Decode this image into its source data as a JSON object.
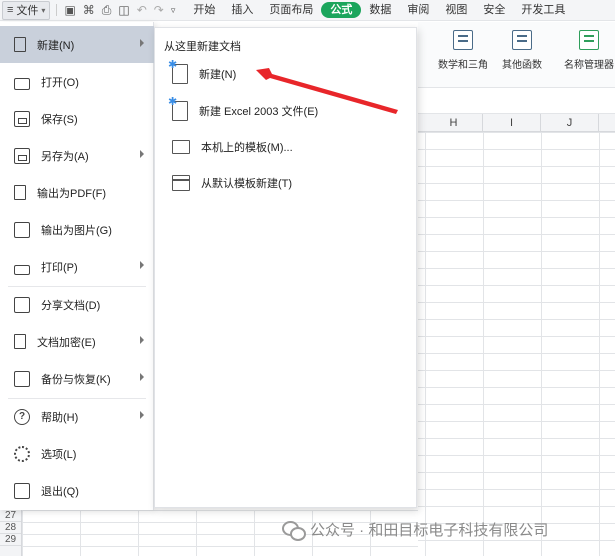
{
  "menubar": {
    "file_label": "文件",
    "tabs": [
      {
        "label": "开始",
        "active": false
      },
      {
        "label": "插入",
        "active": false
      },
      {
        "label": "页面布局",
        "active": false
      },
      {
        "label": "公式",
        "active": true
      },
      {
        "label": "数据",
        "active": false
      },
      {
        "label": "审阅",
        "active": false
      },
      {
        "label": "视图",
        "active": false
      },
      {
        "label": "安全",
        "active": false
      },
      {
        "label": "开发工具",
        "active": false
      }
    ],
    "accent_color": "#1ba55c"
  },
  "ribbon": {
    "math": "数学和三角",
    "other": "其他函数",
    "name_manager": "名称管理器"
  },
  "columns": [
    "H",
    "I",
    "J"
  ],
  "rows": [
    "27",
    "28",
    "29"
  ],
  "file_menu": {
    "items": [
      {
        "label": "新建(N)",
        "icon": "new-doc-icon",
        "submenu": true,
        "active": true
      },
      {
        "label": "打开(O)",
        "icon": "folder-icon",
        "submenu": false
      },
      {
        "label": "保存(S)",
        "icon": "save-icon",
        "submenu": false
      },
      {
        "label": "另存为(A)",
        "icon": "save-as-icon",
        "submenu": true
      },
      {
        "label": "输出为PDF(F)",
        "icon": "pdf-icon",
        "submenu": false
      },
      {
        "label": "输出为图片(G)",
        "icon": "image-icon",
        "submenu": false
      },
      {
        "label": "打印(P)",
        "icon": "printer-icon",
        "submenu": true
      },
      {
        "label": "分享文档(D)",
        "icon": "share-icon",
        "submenu": false
      },
      {
        "label": "文档加密(E)",
        "icon": "encrypt-icon",
        "submenu": true
      },
      {
        "label": "备份与恢复(K)",
        "icon": "backup-icon",
        "submenu": true
      },
      {
        "label": "帮助(H)",
        "icon": "help-icon",
        "submenu": true
      },
      {
        "label": "选项(L)",
        "icon": "gear-icon",
        "submenu": false
      },
      {
        "label": "退出(Q)",
        "icon": "exit-icon",
        "submenu": false
      }
    ]
  },
  "new_panel": {
    "title": "从这里新建文档",
    "items": [
      {
        "label": "新建(N)",
        "icon": "new-doc-icon"
      },
      {
        "label": "新建 Excel 2003 文件(E)",
        "icon": "new-excel-icon"
      },
      {
        "label": "本机上的模板(M)...",
        "icon": "monitor-icon"
      },
      {
        "label": "从默认模板新建(T)",
        "icon": "template-icon"
      }
    ]
  },
  "watermark": "公众号 · 和田目标电子科技有限公司"
}
